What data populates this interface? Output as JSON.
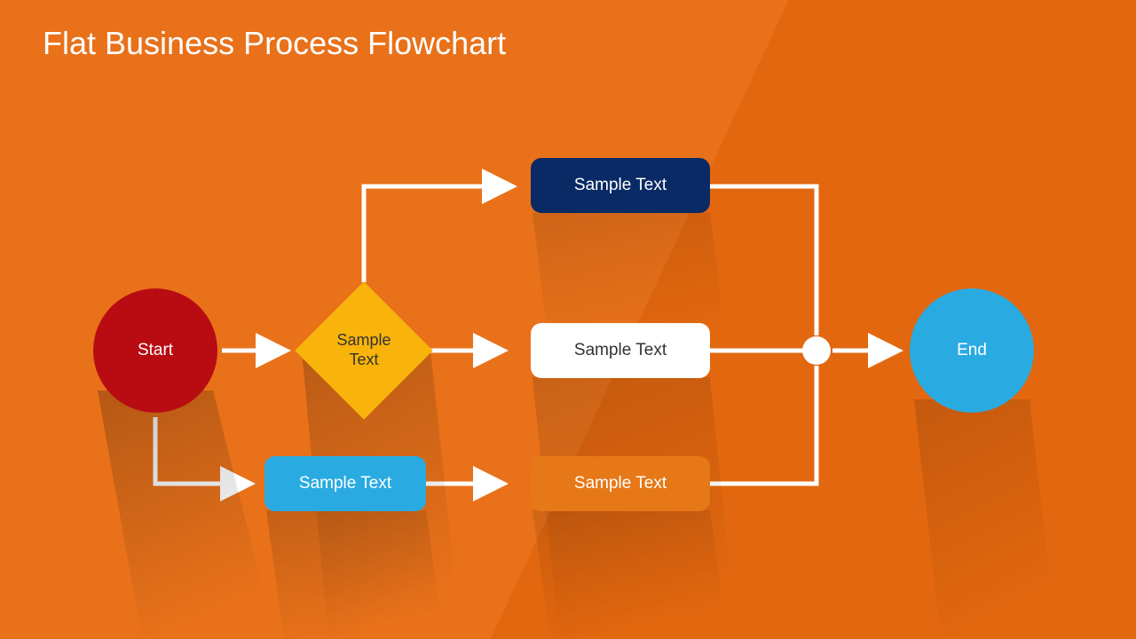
{
  "title": "Flat Business Process Flowchart",
  "nodes": {
    "start": {
      "label": "Start"
    },
    "decision": {
      "label": "Sample Text"
    },
    "topBox": {
      "label": "Sample Text"
    },
    "midBox": {
      "label": "Sample Text"
    },
    "altBox": {
      "label": "Sample Text"
    },
    "lowBox": {
      "label": "Sample Text"
    },
    "end": {
      "label": "End"
    }
  },
  "colors": {
    "start": "#b80c12",
    "decision": "#f8b40a",
    "topBox": "#0a2a66",
    "midBox": "#ffffff",
    "altBox": "#29abe2",
    "lowBox": "#e77817",
    "end": "#29abe2",
    "line": "#ffffff",
    "bg": "#e8711a"
  }
}
